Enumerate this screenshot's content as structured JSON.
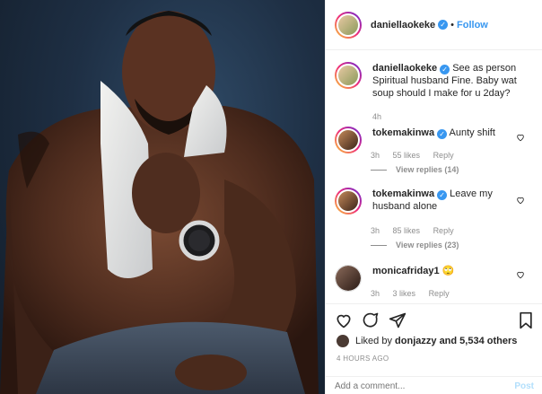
{
  "post": {
    "username": "daniellaokeke",
    "follow_label": "Follow",
    "dot": "•"
  },
  "caption": {
    "username": "daniellaokeke",
    "text": "See as person Spiritual husband Fine. Baby wat soup should I make for u 2day?",
    "time": "4h"
  },
  "comments": [
    {
      "username": "tokemakinwa",
      "text": "Aunty shift",
      "time": "3h",
      "likes": "55 likes",
      "reply": "Reply",
      "view_replies": "View replies (14)"
    },
    {
      "username": "tokemakinwa",
      "text": "Leave my husband alone",
      "time": "3h",
      "likes": "85 likes",
      "reply": "Reply",
      "view_replies": "View replies (23)"
    },
    {
      "username": "monicafriday1",
      "text": "🙄",
      "time": "3h",
      "likes": "3 likes",
      "reply": "Reply"
    }
  ],
  "likes": {
    "prefix": "Liked by",
    "user": "donjazzy",
    "suffix": "and 5,534 others"
  },
  "timestamp": "4 HOURS AGO",
  "add_comment": {
    "placeholder": "Add a comment...",
    "post_label": "Post"
  },
  "icons": {
    "verified": "verified-badge-icon",
    "heart": "heart-icon",
    "comment": "comment-icon",
    "share": "share-icon",
    "save": "bookmark-icon"
  },
  "colors": {
    "accent": "#3897f0",
    "muted": "#8e8e8e",
    "post_disabled": "#b2dffc"
  }
}
